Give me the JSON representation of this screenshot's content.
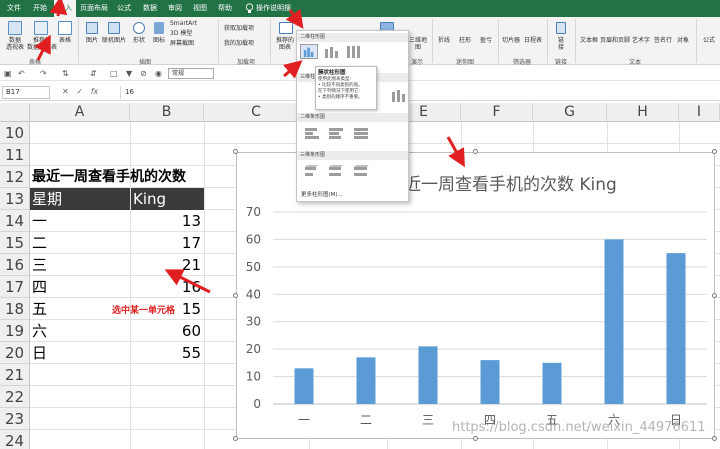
{
  "ribbon": {
    "tabs": [
      "文件",
      "开始",
      "插入",
      "页面布局",
      "公式",
      "数据",
      "审阅",
      "视图",
      "帮助"
    ],
    "active_tab": "插入",
    "tell_me": "操作说明搜索",
    "buttons": {
      "pivot": "数据\n透视表",
      "recommended_pivot": "推荐的\n数据透视表",
      "table": "表格",
      "picture": "图片",
      "online_picture": "联机图片",
      "shapes": "形状",
      "icons": "图标",
      "smartart": "SmartArt",
      "model3d": "3D 模型",
      "screenshot": "屏幕截图",
      "get_addins": "获取加载项",
      "my_addins": "我的加载项",
      "recommended_charts": "推荐的\n图表",
      "map3d": "三维地\n图",
      "line": "折线",
      "column": "柱形",
      "winloss": "盈亏",
      "slicer": "切片器",
      "timeline": "日程表",
      "link": "链\n接",
      "textbox": "文本框",
      "header_footer": "页眉和页脚",
      "wordart": "艺术字",
      "signature": "签名行",
      "object": "对象",
      "equation": "公式"
    },
    "groups": {
      "tables": "表格",
      "illustrations": "插图",
      "addins": "加载项",
      "tours": "演示",
      "sparklines": "迷你图",
      "filters": "筛选器",
      "links": "链接",
      "text": "文本"
    }
  },
  "quick_access": {
    "format": "常规"
  },
  "formula_bar": {
    "name_box": "B17",
    "formula": "16"
  },
  "grid": {
    "columns": [
      "A",
      "B",
      "C",
      "D",
      "E",
      "F",
      "G",
      "H",
      "I"
    ],
    "rows": [
      "10",
      "11",
      "12",
      "13",
      "14",
      "15",
      "16",
      "17",
      "18",
      "19",
      "20",
      "21",
      "22",
      "23",
      "24"
    ],
    "table_title": "最近一周查看手机的次数",
    "header": [
      "星期",
      "King"
    ],
    "data": [
      {
        "day": "一",
        "value": "13"
      },
      {
        "day": "二",
        "value": "17"
      },
      {
        "day": "三",
        "value": "21"
      },
      {
        "day": "四",
        "value": "16"
      },
      {
        "day": "五",
        "value": "15"
      },
      {
        "day": "六",
        "value": "60"
      },
      {
        "day": "日",
        "value": "55"
      }
    ],
    "annotation": "选中某一单元格"
  },
  "dropdown": {
    "section_2d": "二维柱形图",
    "section_3d": "三维柱形图",
    "section_2d_bar": "二维条形图",
    "section_3d_bar": "三维条形图",
    "tooltip_title": "簇状柱形图",
    "tooltip_lines": [
      "使用此图表类型:",
      "• 比较不同类别的值。",
      "在下列情况下使用它:",
      "• 类别的顺序不重要。"
    ],
    "more": "更多柱形图(M)..."
  },
  "chart_data": {
    "type": "bar",
    "title": "最近一周查看手机的次数 King",
    "categories": [
      "一",
      "二",
      "三",
      "四",
      "五",
      "六",
      "日"
    ],
    "series": [
      {
        "name": "King",
        "values": [
          13,
          17,
          21,
          16,
          15,
          60,
          55
        ]
      }
    ],
    "ylim": [
      0,
      70
    ],
    "yticks": [
      "0",
      "10",
      "20",
      "30",
      "40",
      "50",
      "60",
      "70"
    ],
    "grid": true,
    "bar_color": "#5b9bd5"
  },
  "watermark": "https://blog.csdn.net/weixin_44976611",
  "colors": {
    "excel_green": "#217346",
    "annotation_red": "#e02020",
    "bar_blue": "#5b9bd5"
  }
}
